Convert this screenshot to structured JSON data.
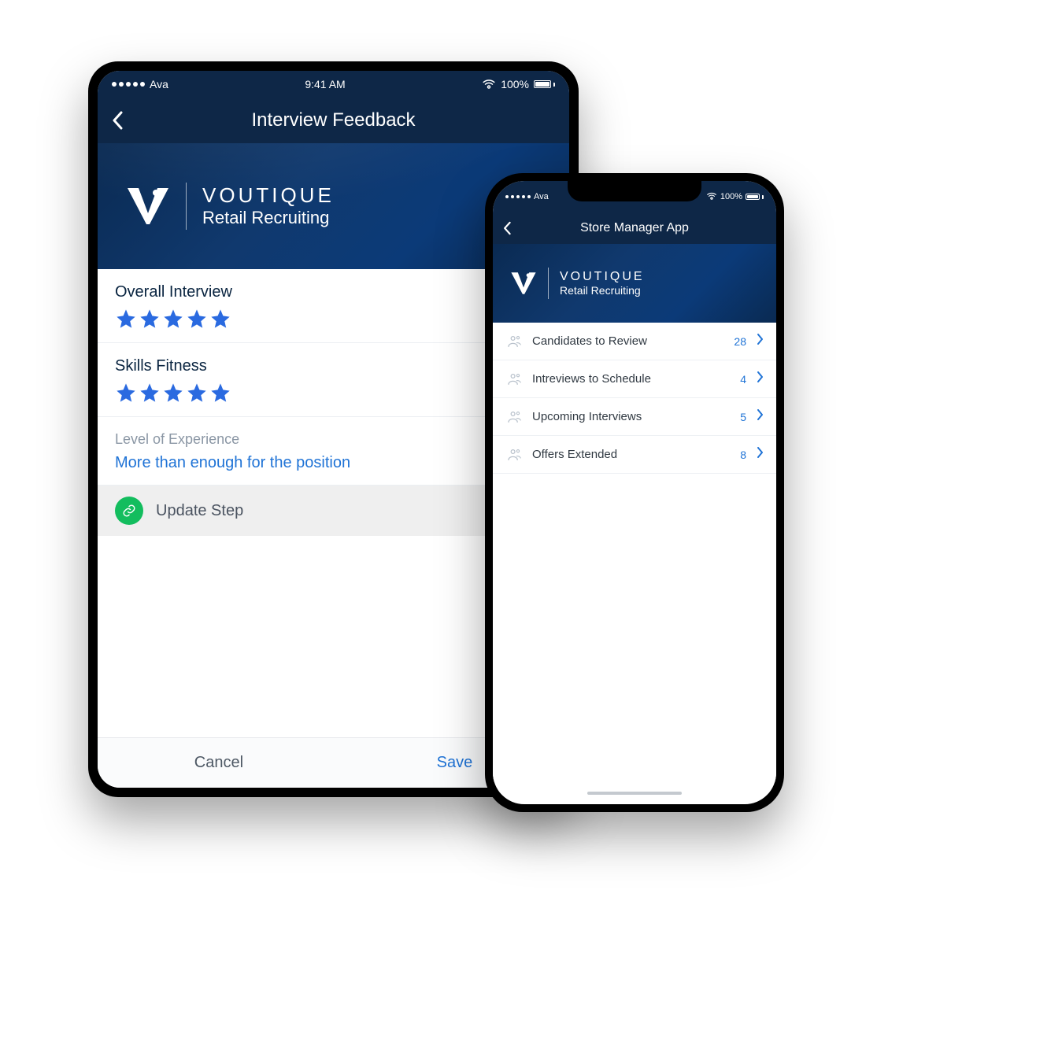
{
  "status": {
    "carrier": "Ava",
    "time": "9:41 AM",
    "level": "100%"
  },
  "tablet": {
    "nav_title": "Interview Feedback",
    "brand_line1": "VOUTIQUE",
    "brand_line2": "Retail Recruiting",
    "ratings": [
      {
        "label": "Overall Interview",
        "stars": 5
      },
      {
        "label": "Skills Fitness",
        "stars": 5
      }
    ],
    "experience": {
      "label": "Level of Experience",
      "value": "More than enough for the position"
    },
    "update_step": "Update Step",
    "cancel": "Cancel",
    "save": "Save"
  },
  "phone": {
    "nav_title": "Store Manager App",
    "brand_line1": "VOUTIQUE",
    "brand_line2": "Retail Recruiting",
    "items": [
      {
        "label": "Candidates to Review",
        "count": 28
      },
      {
        "label": "Intreviews to Schedule",
        "count": 4
      },
      {
        "label": "Upcoming Interviews",
        "count": 5
      },
      {
        "label": "Offers Extended",
        "count": 8
      }
    ]
  }
}
